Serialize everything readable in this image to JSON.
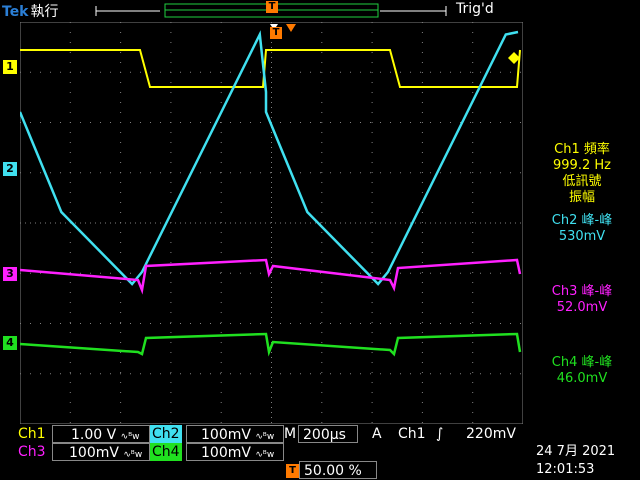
{
  "top": {
    "brand": "Tek",
    "state": "執行",
    "trigger_status": "Trig'd"
  },
  "markers": {
    "ch1": "1",
    "ch2": "2",
    "ch3": "3",
    "ch4": "4",
    "trigger": "T"
  },
  "measurements": {
    "ch1_label": "Ch1 頻率",
    "ch1_value": "999.2 Hz",
    "ch1_note1": "低訊號",
    "ch1_note2": "振幅",
    "ch2_label": "Ch2 峰-峰",
    "ch2_value": "530mV",
    "ch3_label": "Ch3 峰-峰",
    "ch3_value": "52.0mV",
    "ch4_label": "Ch4 峰-峰",
    "ch4_value": "46.0mV"
  },
  "bottom": {
    "ch1_name": "Ch1",
    "ch1_scale": "1.00 V",
    "ch2_name": "Ch2",
    "ch2_scale": "100mV",
    "ch3_name": "Ch3",
    "ch3_scale": "100mV",
    "ch4_name": "Ch4",
    "ch4_scale": "100mV",
    "bw_symbol": "∿ᴮw",
    "timebase_label": "M",
    "timebase": "200µs",
    "trigger_mode": "A",
    "trigger_source": "Ch1",
    "trigger_slope": "∫",
    "trigger_level": "220mV",
    "trigger_pos_marker": "T",
    "trigger_position": "50.00 %",
    "date": "24 7月  2021",
    "time": "12:01:53"
  },
  "colors": {
    "ch1": "#ffff00",
    "ch2": "#40e0f0",
    "ch3": "#ff20ff",
    "ch4": "#20e020",
    "trigger": "#ff7a00",
    "grid": "#808080"
  }
}
